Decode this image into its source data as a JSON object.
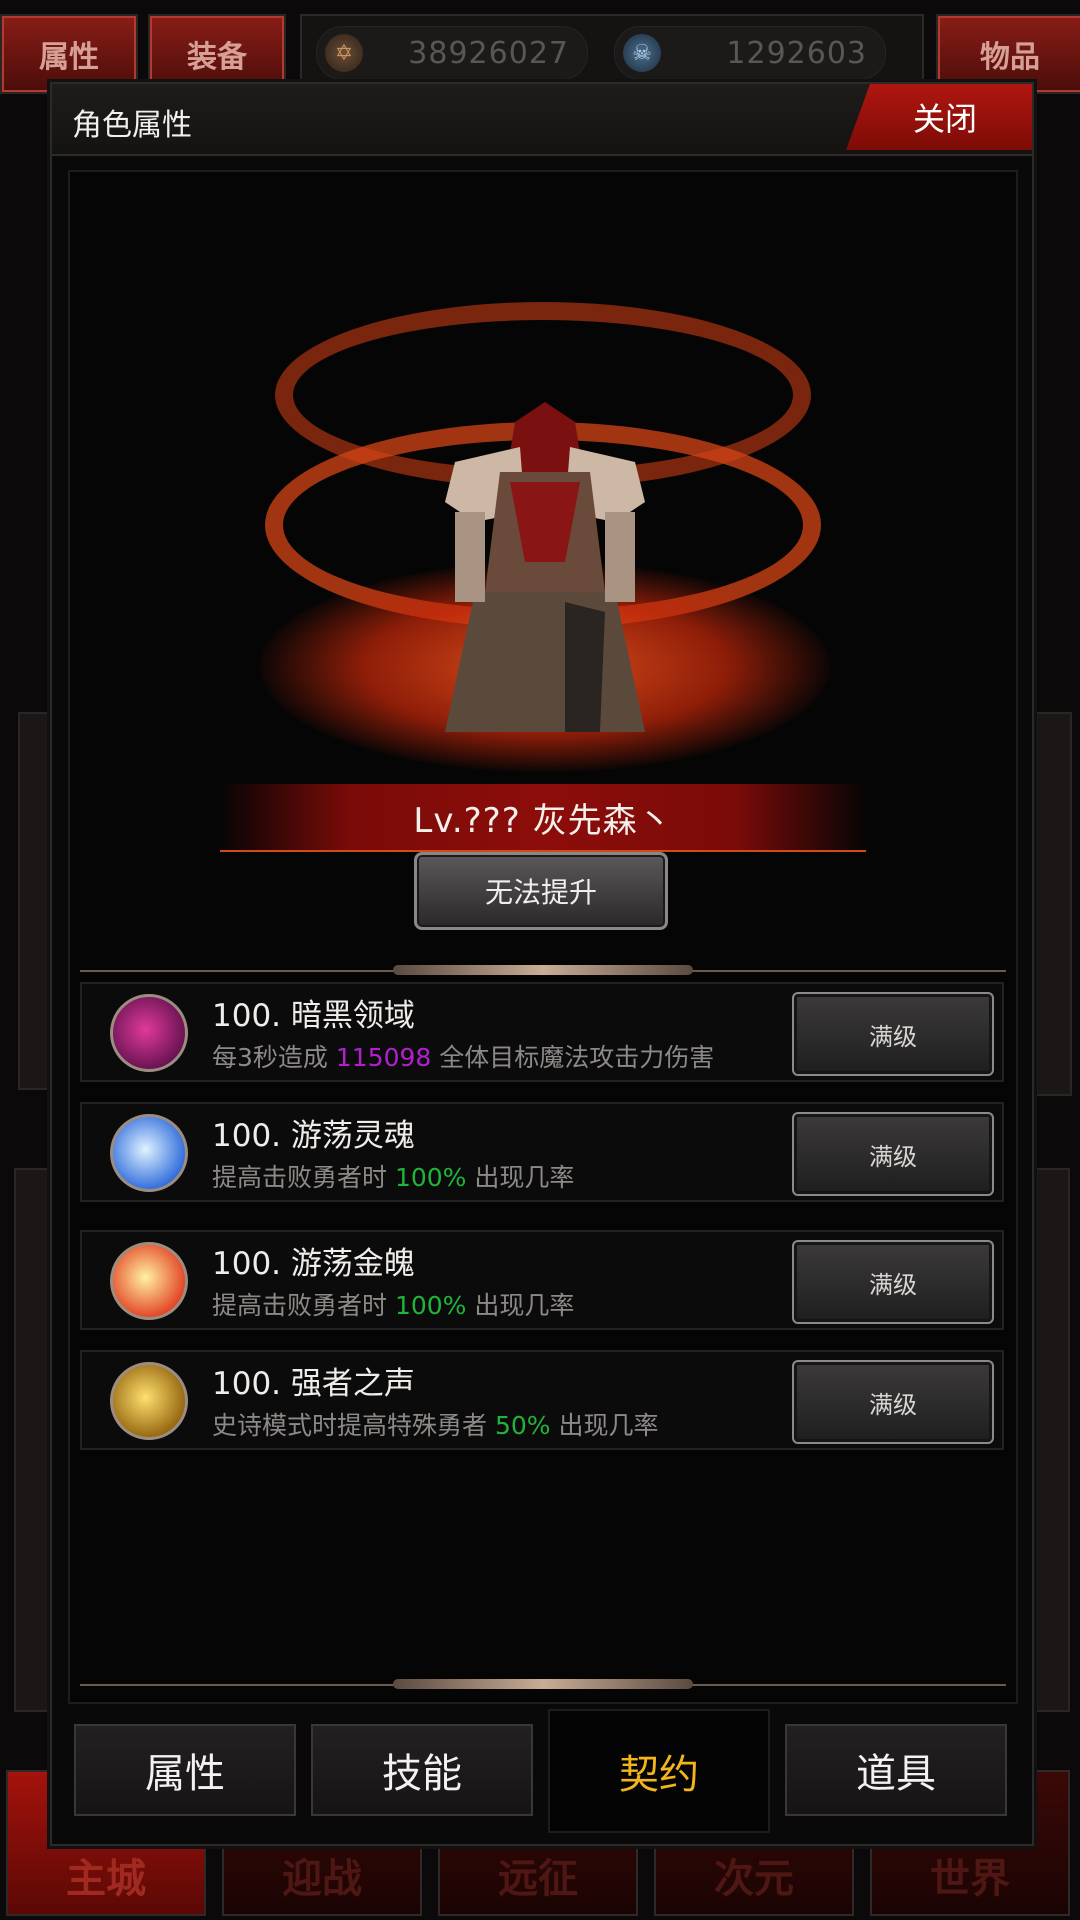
{
  "background": {
    "top_left_tabs": [
      "属性",
      "装备"
    ],
    "top_right_tab": "物品",
    "currencies": [
      {
        "icon": "gold-coin-icon",
        "amount": "38926027"
      },
      {
        "icon": "skull-coin-icon",
        "amount": "1292603"
      }
    ],
    "bottom_nav": [
      "主城",
      "迎战",
      "远征",
      "次元",
      "世界"
    ]
  },
  "modal": {
    "title": "角色属性",
    "close_label": "关闭",
    "character_name": "Lv.??? 灰先森丶",
    "upgrade_label": "无法提升",
    "skills": [
      {
        "title": "100. 暗黑领域",
        "desc_pre": "每3秒造成 ",
        "value": "115098",
        "value_color": "purple",
        "desc_post": " 全体目标魔法攻击力伤害",
        "button": "满级",
        "icon": "dark-domain-icon",
        "icon_colors": [
          "#e03a9a",
          "#5b0f4a"
        ]
      },
      {
        "title": "100. 游荡灵魂",
        "desc_pre": "提高击败勇者时 ",
        "value": "100%",
        "value_color": "green",
        "desc_post": " 出现几率",
        "button": "满级",
        "icon": "wandering-soul-icon",
        "icon_colors": [
          "#dff2ff",
          "#1f5fd8"
        ]
      },
      {
        "title": "100. 游荡金魄",
        "desc_pre": "提高击败勇者时 ",
        "value": "100%",
        "value_color": "green",
        "desc_post": " 出现几率",
        "button": "满级",
        "icon": "wandering-gold-soul-icon",
        "icon_colors": [
          "#fff1a0",
          "#e0321a"
        ]
      },
      {
        "title": "100. 强者之声",
        "desc_pre": "史诗模式时提高特殊勇者 ",
        "value": "50%",
        "value_color": "green",
        "desc_post": " 出现几率",
        "button": "满级",
        "icon": "voice-of-strong-icon",
        "icon_colors": [
          "#ffe070",
          "#8a5a05"
        ]
      }
    ],
    "tabs": [
      {
        "label": "属性",
        "active": false
      },
      {
        "label": "技能",
        "active": false
      },
      {
        "label": "契约",
        "active": true
      },
      {
        "label": "道具",
        "active": false
      }
    ]
  }
}
